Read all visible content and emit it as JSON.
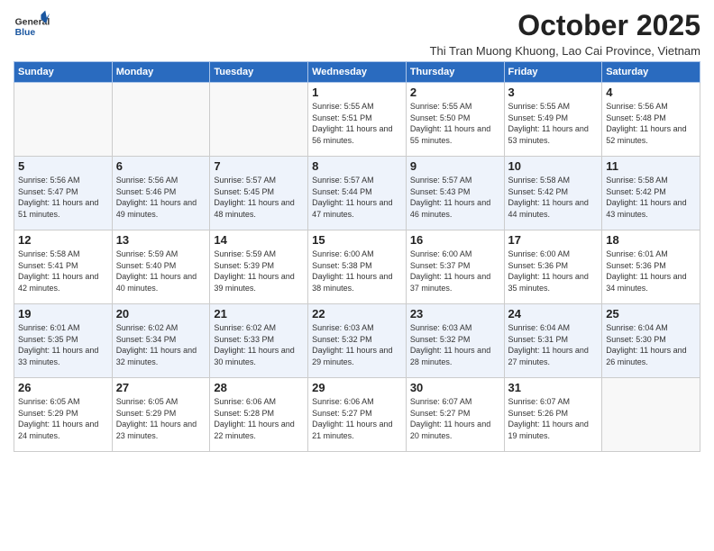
{
  "header": {
    "logo_general": "General",
    "logo_blue": "Blue",
    "month": "October 2025",
    "location": "Thi Tran Muong Khuong, Lao Cai Province, Vietnam"
  },
  "days_of_week": [
    "Sunday",
    "Monday",
    "Tuesday",
    "Wednesday",
    "Thursday",
    "Friday",
    "Saturday"
  ],
  "weeks": [
    [
      {
        "day": "",
        "info": ""
      },
      {
        "day": "",
        "info": ""
      },
      {
        "day": "",
        "info": ""
      },
      {
        "day": "1",
        "sunrise": "5:55 AM",
        "sunset": "5:51 PM",
        "daylight": "11 hours and 56 minutes."
      },
      {
        "day": "2",
        "sunrise": "5:55 AM",
        "sunset": "5:50 PM",
        "daylight": "11 hours and 55 minutes."
      },
      {
        "day": "3",
        "sunrise": "5:55 AM",
        "sunset": "5:49 PM",
        "daylight": "11 hours and 53 minutes."
      },
      {
        "day": "4",
        "sunrise": "5:56 AM",
        "sunset": "5:48 PM",
        "daylight": "11 hours and 52 minutes."
      }
    ],
    [
      {
        "day": "5",
        "sunrise": "5:56 AM",
        "sunset": "5:47 PM",
        "daylight": "11 hours and 51 minutes."
      },
      {
        "day": "6",
        "sunrise": "5:56 AM",
        "sunset": "5:46 PM",
        "daylight": "11 hours and 49 minutes."
      },
      {
        "day": "7",
        "sunrise": "5:57 AM",
        "sunset": "5:45 PM",
        "daylight": "11 hours and 48 minutes."
      },
      {
        "day": "8",
        "sunrise": "5:57 AM",
        "sunset": "5:44 PM",
        "daylight": "11 hours and 47 minutes."
      },
      {
        "day": "9",
        "sunrise": "5:57 AM",
        "sunset": "5:43 PM",
        "daylight": "11 hours and 46 minutes."
      },
      {
        "day": "10",
        "sunrise": "5:58 AM",
        "sunset": "5:42 PM",
        "daylight": "11 hours and 44 minutes."
      },
      {
        "day": "11",
        "sunrise": "5:58 AM",
        "sunset": "5:42 PM",
        "daylight": "11 hours and 43 minutes."
      }
    ],
    [
      {
        "day": "12",
        "sunrise": "5:58 AM",
        "sunset": "5:41 PM",
        "daylight": "11 hours and 42 minutes."
      },
      {
        "day": "13",
        "sunrise": "5:59 AM",
        "sunset": "5:40 PM",
        "daylight": "11 hours and 40 minutes."
      },
      {
        "day": "14",
        "sunrise": "5:59 AM",
        "sunset": "5:39 PM",
        "daylight": "11 hours and 39 minutes."
      },
      {
        "day": "15",
        "sunrise": "6:00 AM",
        "sunset": "5:38 PM",
        "daylight": "11 hours and 38 minutes."
      },
      {
        "day": "16",
        "sunrise": "6:00 AM",
        "sunset": "5:37 PM",
        "daylight": "11 hours and 37 minutes."
      },
      {
        "day": "17",
        "sunrise": "6:00 AM",
        "sunset": "5:36 PM",
        "daylight": "11 hours and 35 minutes."
      },
      {
        "day": "18",
        "sunrise": "6:01 AM",
        "sunset": "5:36 PM",
        "daylight": "11 hours and 34 minutes."
      }
    ],
    [
      {
        "day": "19",
        "sunrise": "6:01 AM",
        "sunset": "5:35 PM",
        "daylight": "11 hours and 33 minutes."
      },
      {
        "day": "20",
        "sunrise": "6:02 AM",
        "sunset": "5:34 PM",
        "daylight": "11 hours and 32 minutes."
      },
      {
        "day": "21",
        "sunrise": "6:02 AM",
        "sunset": "5:33 PM",
        "daylight": "11 hours and 30 minutes."
      },
      {
        "day": "22",
        "sunrise": "6:03 AM",
        "sunset": "5:32 PM",
        "daylight": "11 hours and 29 minutes."
      },
      {
        "day": "23",
        "sunrise": "6:03 AM",
        "sunset": "5:32 PM",
        "daylight": "11 hours and 28 minutes."
      },
      {
        "day": "24",
        "sunrise": "6:04 AM",
        "sunset": "5:31 PM",
        "daylight": "11 hours and 27 minutes."
      },
      {
        "day": "25",
        "sunrise": "6:04 AM",
        "sunset": "5:30 PM",
        "daylight": "11 hours and 26 minutes."
      }
    ],
    [
      {
        "day": "26",
        "sunrise": "6:05 AM",
        "sunset": "5:29 PM",
        "daylight": "11 hours and 24 minutes."
      },
      {
        "day": "27",
        "sunrise": "6:05 AM",
        "sunset": "5:29 PM",
        "daylight": "11 hours and 23 minutes."
      },
      {
        "day": "28",
        "sunrise": "6:06 AM",
        "sunset": "5:28 PM",
        "daylight": "11 hours and 22 minutes."
      },
      {
        "day": "29",
        "sunrise": "6:06 AM",
        "sunset": "5:27 PM",
        "daylight": "11 hours and 21 minutes."
      },
      {
        "day": "30",
        "sunrise": "6:07 AM",
        "sunset": "5:27 PM",
        "daylight": "11 hours and 20 minutes."
      },
      {
        "day": "31",
        "sunrise": "6:07 AM",
        "sunset": "5:26 PM",
        "daylight": "11 hours and 19 minutes."
      },
      {
        "day": "",
        "info": ""
      }
    ]
  ]
}
